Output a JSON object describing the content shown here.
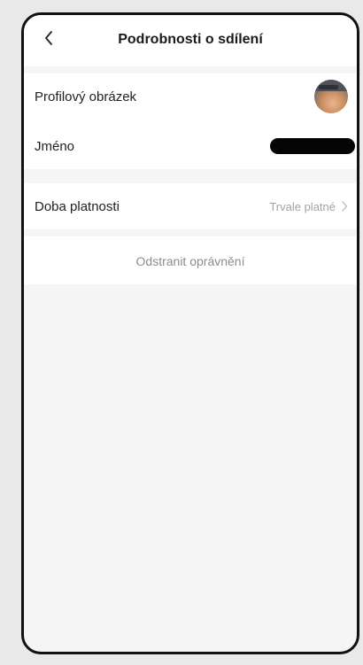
{
  "header": {
    "title": "Podrobnosti o sdílení",
    "back_icon": "chevron-left-icon"
  },
  "profile": {
    "avatar_label": "Profilový obrázek",
    "name_label": "Jméno",
    "name_value_redacted": true
  },
  "validity": {
    "label": "Doba platnosti",
    "value": "Trvale platné",
    "chevron_icon": "chevron-right-icon"
  },
  "actions": {
    "remove_label": "Odstranit oprávnění"
  },
  "colors": {
    "background": "#f5f5f5",
    "card": "#ffffff",
    "text": "#1f1f1f",
    "muted": "#a3a3a3",
    "action": "#8c8c8c"
  }
}
